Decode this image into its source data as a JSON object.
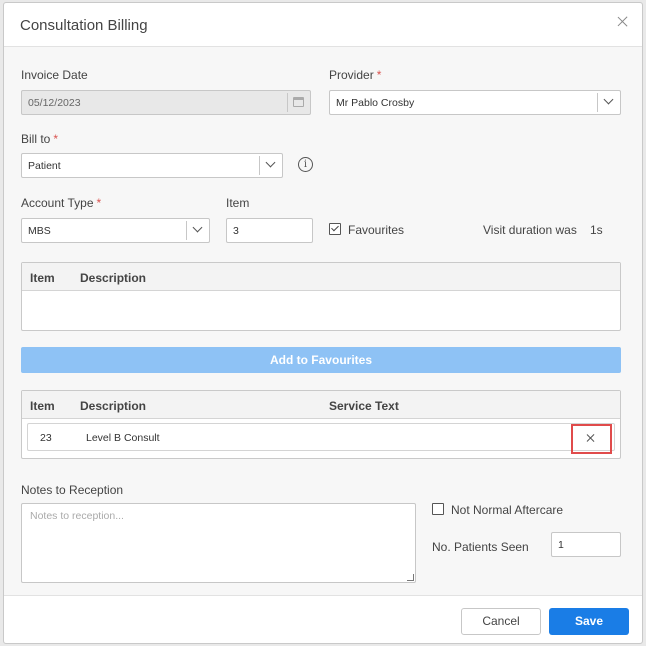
{
  "dialog": {
    "title": "Consultation Billing"
  },
  "invoice_date": {
    "label": "Invoice Date",
    "value": "05/12/2023"
  },
  "provider": {
    "label": "Provider",
    "value": "Mr Pablo Crosby"
  },
  "bill_to": {
    "label": "Bill to",
    "value": "Patient"
  },
  "account_type": {
    "label": "Account Type",
    "value": "MBS"
  },
  "item": {
    "label": "Item",
    "value": "3"
  },
  "favourites": {
    "label": "Favourites",
    "checked": true
  },
  "visit": {
    "label": "Visit duration was",
    "value": "1s"
  },
  "search_table": {
    "headers": [
      "Item",
      "Description"
    ]
  },
  "add_favourites_label": "Add to Favourites",
  "billing_table": {
    "headers": [
      "Item",
      "Description",
      "Service Text"
    ],
    "rows": [
      {
        "item": "23",
        "description": "Level B Consult",
        "service_text": ""
      }
    ]
  },
  "notes": {
    "label": "Notes to Reception",
    "placeholder": "Notes to reception..."
  },
  "not_normal_aftercare": {
    "label": "Not Normal Aftercare",
    "checked": false
  },
  "patients_seen": {
    "label": "No. Patients Seen",
    "value": "1"
  },
  "footer": {
    "cancel_label": "Cancel",
    "save_label": "Save"
  },
  "colors": {
    "primary": "#1a7de6",
    "primary_disabled": "#8ec2f5",
    "required": "#d9534f",
    "highlight": "#e04b4b"
  }
}
